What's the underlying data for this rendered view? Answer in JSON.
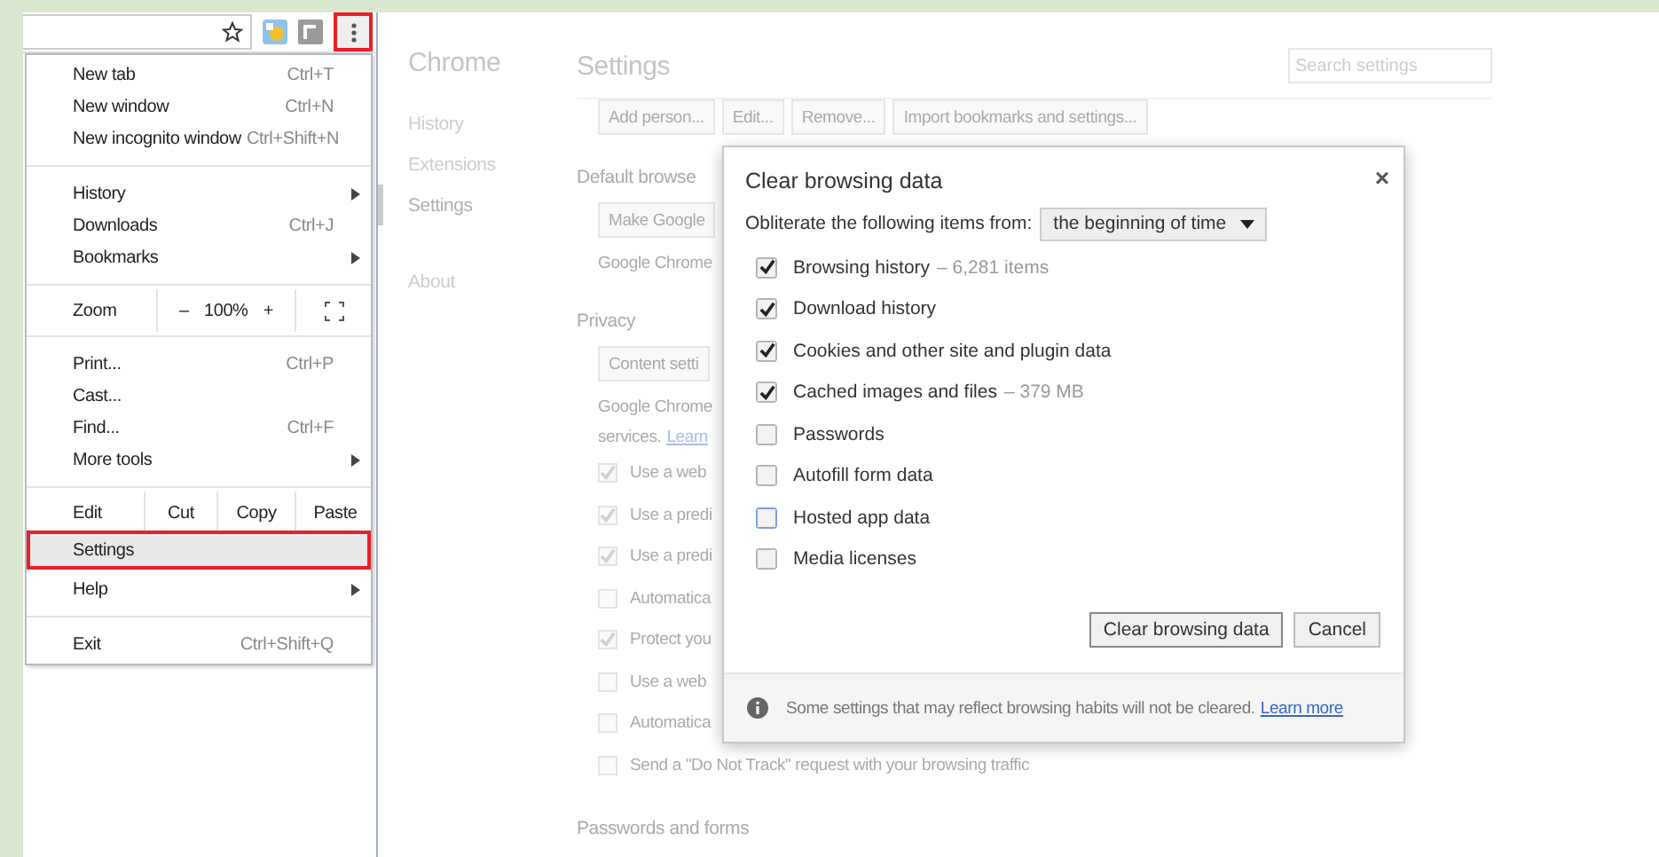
{
  "toolbar": {
    "menu_button": {
      "highlighted": true
    }
  },
  "menu": [
    {
      "kind": "item",
      "label": "New tab",
      "shortcut": "Ctrl+T",
      "submenu": false,
      "highlighted": false
    },
    {
      "kind": "item",
      "label": "New window",
      "shortcut": "Ctrl+N",
      "submenu": false,
      "highlighted": false
    },
    {
      "kind": "item",
      "label": "New incognito window",
      "shortcut": "Ctrl+Shift+N",
      "submenu": false,
      "highlighted": false
    },
    {
      "kind": "separator"
    },
    {
      "kind": "item",
      "label": "History",
      "submenu": true,
      "highlighted": false
    },
    {
      "kind": "item",
      "label": "Downloads",
      "shortcut": "Ctrl+J",
      "submenu": false,
      "highlighted": false
    },
    {
      "kind": "item",
      "label": "Bookmarks",
      "submenu": true,
      "highlighted": false
    },
    {
      "kind": "separator"
    },
    {
      "kind": "zoom",
      "label": "Zoom",
      "minus": "–",
      "value": "100%",
      "plus": "+"
    },
    {
      "kind": "separator"
    },
    {
      "kind": "item",
      "label": "Print...",
      "shortcut": "Ctrl+P",
      "submenu": false,
      "highlighted": false
    },
    {
      "kind": "item",
      "label": "Cast...",
      "submenu": false,
      "highlighted": false
    },
    {
      "kind": "item",
      "label": "Find...",
      "shortcut": "Ctrl+F",
      "submenu": false,
      "highlighted": false
    },
    {
      "kind": "item",
      "label": "More tools",
      "submenu": true,
      "highlighted": false
    },
    {
      "kind": "separator"
    },
    {
      "kind": "edit",
      "label": "Edit",
      "buttons": [
        "Cut",
        "Copy",
        "Paste"
      ]
    },
    {
      "kind": "item",
      "label": "Settings",
      "submenu": false,
      "highlighted": true
    },
    {
      "kind": "item",
      "label": "Help",
      "submenu": true,
      "highlighted": false
    },
    {
      "kind": "separator"
    },
    {
      "kind": "item",
      "label": "Exit",
      "shortcut": "Ctrl+Shift+Q",
      "submenu": false,
      "highlighted": false
    }
  ],
  "settings_page": {
    "app_title": "Chrome",
    "nav": [
      {
        "label": "History",
        "selected": false
      },
      {
        "label": "Extensions",
        "selected": false
      },
      {
        "label": "Settings",
        "selected": true
      }
    ],
    "nav_footer": [
      {
        "label": "About",
        "selected": false
      }
    ],
    "title": "Settings",
    "search": {
      "placeholder": "Search settings"
    },
    "people_buttons": [
      "Add person...",
      "Edit...",
      "Remove...",
      "Import bookmarks and settings..."
    ],
    "blocks": [
      {
        "kind": "heading",
        "text": "Default browse"
      },
      {
        "kind": "button",
        "text": "Make Google"
      },
      {
        "kind": "text",
        "text": "Google Chrome"
      },
      {
        "kind": "heading",
        "text": "Privacy"
      },
      {
        "kind": "button",
        "text": "Content setti"
      },
      {
        "kind": "text",
        "text": "Google Chrome"
      },
      {
        "kind": "text_link",
        "text": "services.",
        "link": "Learn"
      },
      {
        "kind": "checkbox",
        "text": "Use a web",
        "checked": true
      },
      {
        "kind": "checkbox",
        "text": "Use a predi",
        "checked": true
      },
      {
        "kind": "checkbox",
        "text": "Use a predi",
        "checked": true
      },
      {
        "kind": "checkbox",
        "text": "Automatica",
        "checked": false
      },
      {
        "kind": "checkbox",
        "text": "Protect you",
        "checked": true
      },
      {
        "kind": "checkbox",
        "text": "Use a web",
        "checked": false
      },
      {
        "kind": "checkbox",
        "text": "Automatica",
        "checked": false
      },
      {
        "kind": "checkbox",
        "text": "Send a \"Do Not Track\" request with your browsing traffic",
        "checked": false
      },
      {
        "kind": "heading",
        "text": "Passwords and forms"
      }
    ]
  },
  "dialog": {
    "title": "Clear browsing data",
    "close": "×",
    "range_label": "Obliterate the following items from:",
    "range_value": "the beginning of time",
    "options": [
      {
        "label": "Browsing history",
        "detail": "– 6,281 items",
        "checked": true,
        "focused": false
      },
      {
        "label": "Download history",
        "checked": true,
        "focused": false
      },
      {
        "label": "Cookies and other site and plugin data",
        "checked": true,
        "focused": false
      },
      {
        "label": "Cached images and files",
        "detail": "– 379 MB",
        "checked": true,
        "focused": false
      },
      {
        "label": "Passwords",
        "checked": false,
        "focused": false
      },
      {
        "label": "Autofill form data",
        "checked": false,
        "focused": false
      },
      {
        "label": "Hosted app data",
        "checked": false,
        "focused": true
      },
      {
        "label": "Media licenses",
        "checked": false,
        "focused": false
      }
    ],
    "buttons": [
      {
        "label": "Clear browsing data",
        "default": true
      },
      {
        "label": "Cancel",
        "default": false
      }
    ],
    "footer": {
      "text": "Some settings that may reflect browsing habits will not be cleared.",
      "link": "Learn more"
    }
  }
}
